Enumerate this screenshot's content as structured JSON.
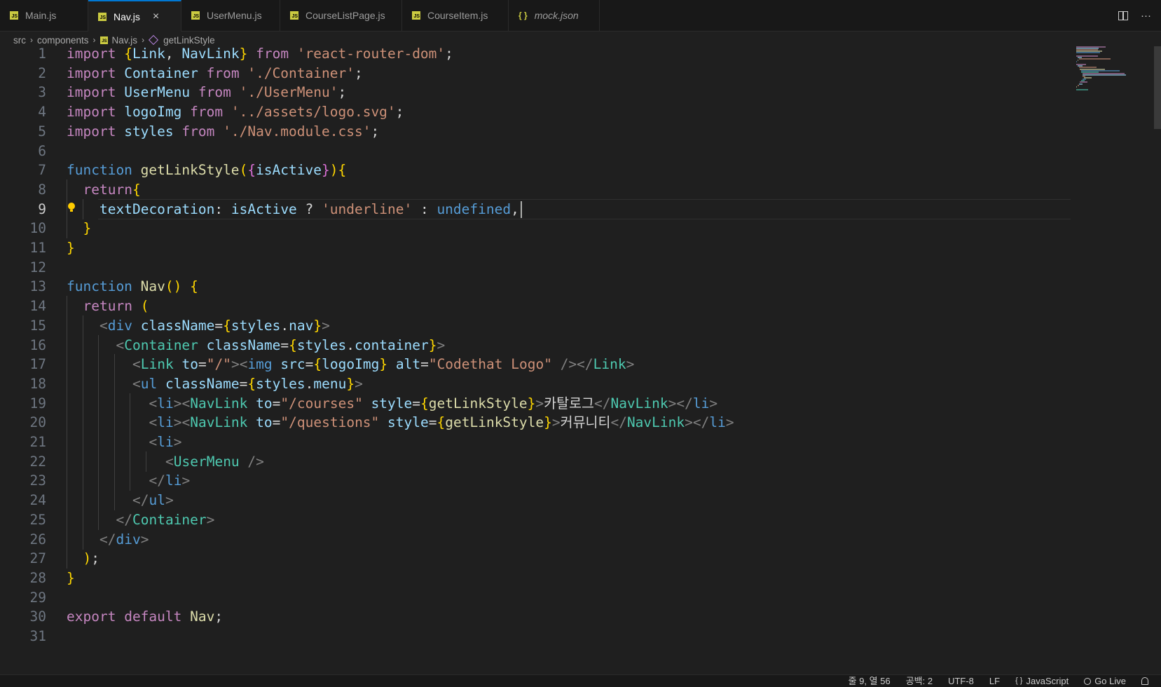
{
  "tabs": [
    {
      "label": "Main.js",
      "type": "js",
      "active": false
    },
    {
      "label": "Nav.js",
      "type": "js",
      "active": true
    },
    {
      "label": "UserMenu.js",
      "type": "js",
      "active": false
    },
    {
      "label": "CourseListPage.js",
      "type": "js",
      "active": false
    },
    {
      "label": "CourseItem.js",
      "type": "js",
      "active": false
    },
    {
      "label": "mock.json",
      "type": "json",
      "active": false
    }
  ],
  "tab_icons": {
    "js": "JS",
    "json": "{ }",
    "close": "×"
  },
  "tabbar_actions": {
    "more": "···"
  },
  "breadcrumb": {
    "items": [
      "src",
      "components",
      "Nav.js",
      "getLinkStyle"
    ],
    "separator": "›"
  },
  "editor": {
    "line_numbers": [
      "1",
      "2",
      "3",
      "4",
      "5",
      "6",
      "7",
      "8",
      "9",
      "10",
      "11",
      "12",
      "13",
      "14",
      "15",
      "16",
      "17",
      "18",
      "19",
      "20",
      "21",
      "22",
      "23",
      "24",
      "25",
      "26",
      "27",
      "28",
      "29",
      "30",
      "31"
    ],
    "current_line": 9,
    "lines": [
      "import {Link, NavLink} from 'react-router-dom';",
      "import Container from './Container';",
      "import UserMenu from './UserMenu';",
      "import logoImg from '../assets/logo.svg';",
      "import styles from './Nav.module.css';",
      "",
      "function getLinkStyle({isActive}){",
      "  return{",
      "    textDecoration: isActive ? 'underline' : undefined,",
      "  }",
      "}",
      "",
      "function Nav() {",
      "  return (",
      "    <div className={styles.nav}>",
      "      <Container className={styles.container}>",
      "        <Link to=\"/\"><img src={logoImg} alt=\"Codethat Logo\" /></Link>",
      "        <ul className={styles.menu}>",
      "          <li><NavLink to=\"/courses\" style={getLinkStyle}>카탈로그</NavLink></li>",
      "          <li><NavLink to=\"/questions\" style={getLinkStyle}>커뮤니티</NavLink></li>",
      "          <li>",
      "            <UserMenu />",
      "          </li>",
      "        </ul>",
      "      </Container>",
      "    </div>",
      "  );",
      "}",
      "",
      "export default Nav;",
      ""
    ]
  },
  "colors": {
    "background": "#1f1f1f",
    "tab_active_border": "#0078d4",
    "keyword": "#c586c0",
    "storage": "#569cd6",
    "string": "#ce9178",
    "variable": "#9cdcfe",
    "function": "#dcdcaa",
    "class": "#4ec9b0"
  },
  "status": {
    "position": "줄 9, 열 56",
    "spaces": "공백: 2",
    "encoding": "UTF-8",
    "eol": "LF",
    "language": "JavaScript",
    "go_live": "Go Live"
  }
}
